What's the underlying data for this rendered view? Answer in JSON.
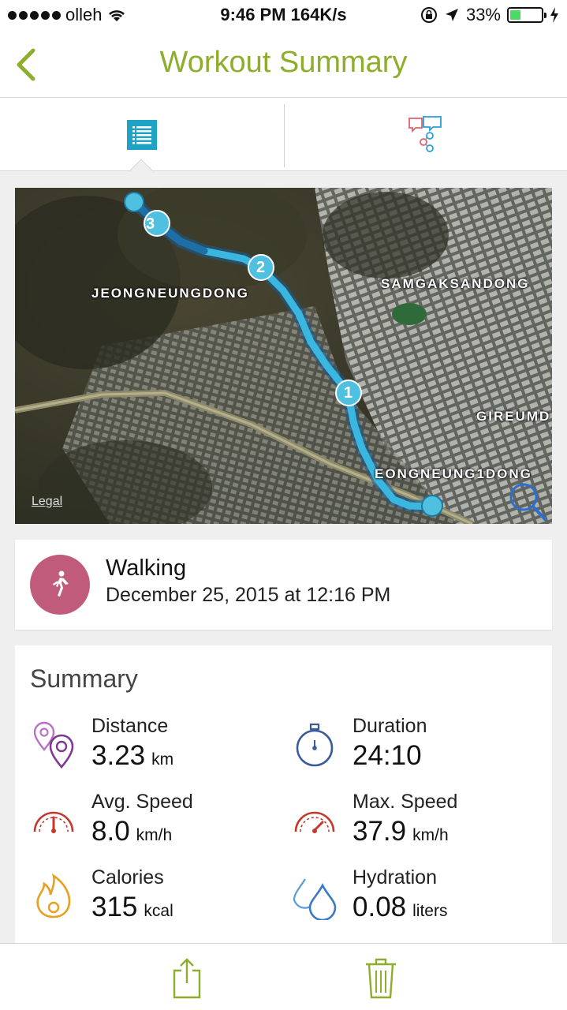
{
  "status_bar": {
    "carrier": "olleh",
    "time_and_rate": "9:46 PM 164K/s",
    "battery_percent": "33%",
    "battery_level": 0.33
  },
  "nav": {
    "title": "Workout Summary",
    "accent_color": "#8cae2b"
  },
  "segments": {
    "details_icon": "list-icon",
    "social_icon": "share-chat-icon",
    "selected": "details"
  },
  "map": {
    "labels": [
      "JEONGNEUNGDONG",
      "SAMGAKSANDONG",
      "GIREUMD",
      "EONGNEUNG1DONG"
    ],
    "legal": "Legal",
    "markers": [
      "1",
      "2",
      "3"
    ],
    "route_color": "#39b7e0"
  },
  "activity": {
    "type": "Walking",
    "date": "December 25, 2015 at 12:16 PM",
    "icon_color": "#c05b7b"
  },
  "summary": {
    "title": "Summary",
    "stats": [
      {
        "label": "Distance",
        "value": "3.23",
        "unit": "km",
        "icon": "location-pins-icon"
      },
      {
        "label": "Duration",
        "value": "24:10",
        "unit": "",
        "icon": "stopwatch-icon"
      },
      {
        "label": "Avg. Speed",
        "value": "8.0",
        "unit": "km/h",
        "icon": "speedometer-icon"
      },
      {
        "label": "Max. Speed",
        "value": "37.9",
        "unit": "km/h",
        "icon": "speedometer-icon"
      },
      {
        "label": "Calories",
        "value": "315",
        "unit": "kcal",
        "icon": "flame-icon"
      },
      {
        "label": "Hydration",
        "value": "0.08",
        "unit": "liters",
        "icon": "water-drops-icon"
      }
    ]
  },
  "toolbar": {
    "share_icon": "share-icon",
    "delete_icon": "trash-icon"
  }
}
